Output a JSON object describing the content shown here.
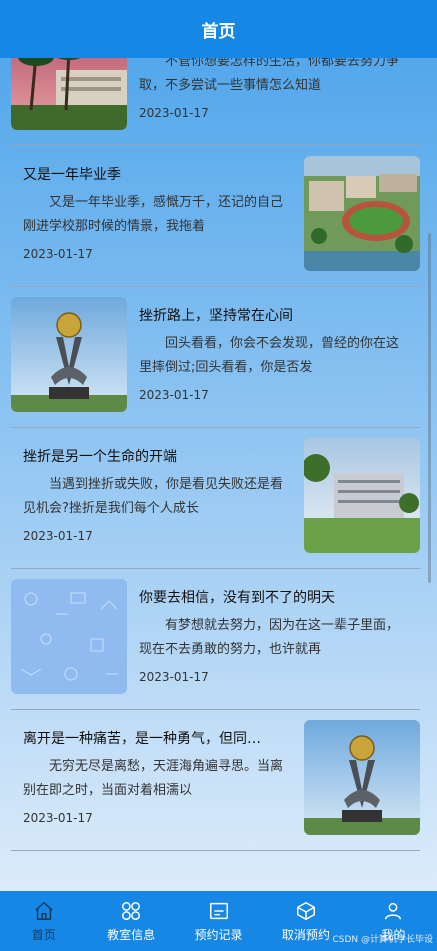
{
  "header": {
    "title": "首页"
  },
  "articles": [
    {
      "title": "",
      "desc": "不管你想要怎样的生活，你都要去努力争取，不多尝试一些事情怎么知道",
      "date": "2023-01-17",
      "image": "campus-palms",
      "image_side": "left"
    },
    {
      "title": "又是一年毕业季",
      "desc": "又是一年毕业季，感慨万千，还记的自己刚进学校那时候的情景，我拖着",
      "date": "2023-01-17",
      "image": "campus-aerial",
      "image_side": "right"
    },
    {
      "title": "挫折路上，坚持常在心间",
      "desc": "回头看看，你会不会发现，曾经的你在这里摔倒过;回头看看，你是否发",
      "date": "2023-01-17",
      "image": "campus-sculpture",
      "image_side": "left"
    },
    {
      "title": "挫折是另一个生命的开端",
      "desc": "当遇到挫折或失败，你是看见失败还是看见机会?挫折是我们每个人成长",
      "date": "2023-01-17",
      "image": "campus-building",
      "image_side": "right"
    },
    {
      "title": "你要去相信，没有到不了的明天",
      "desc": "有梦想就去努力，因为在这一辈子里面，现在不去勇敢的努力，也许就再",
      "date": "2023-01-17",
      "image": "blue-pattern",
      "image_side": "left"
    },
    {
      "title": "离开是一种痛苦，是一种勇气，但同…",
      "desc": "无穷无尽是离愁，天涯海角遍寻思。当离别在即之时，当面对着相濡以",
      "date": "2023-01-17",
      "image": "campus-sculpture",
      "image_side": "right"
    }
  ],
  "tabs": [
    {
      "label": "首页",
      "icon": "home-icon",
      "active": true
    },
    {
      "label": "教室信息",
      "icon": "grid-icon",
      "active": false
    },
    {
      "label": "预约记录",
      "icon": "record-icon",
      "active": false
    },
    {
      "label": "取消预约",
      "icon": "box-icon",
      "active": false
    },
    {
      "label": "我的",
      "icon": "user-icon",
      "active": false
    }
  ],
  "watermark": "CSDN @计算机学长毕设",
  "colors": {
    "accent": "#1787e6",
    "tab_active": "#123a5e"
  }
}
